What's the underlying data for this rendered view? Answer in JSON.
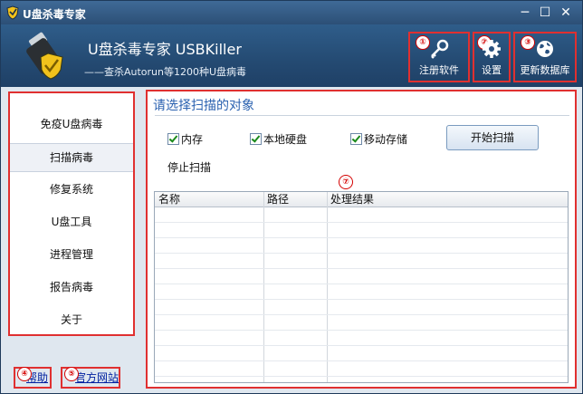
{
  "window": {
    "title": "U盘杀毒专家"
  },
  "header": {
    "app_name": "U盘杀毒专家   USBKiller",
    "tagline": "——查杀Autorun等1200种U盘病毒",
    "buttons": [
      {
        "label": "注册软件",
        "badge": "①",
        "icon": "key-icon"
      },
      {
        "label": "设置",
        "badge": "②",
        "icon": "gear-icon"
      },
      {
        "label": "更新数据库",
        "badge": "③",
        "icon": "globe-icon"
      }
    ]
  },
  "sidebar": {
    "badge": "⑥",
    "items": [
      {
        "label": "免疫U盘病毒"
      },
      {
        "label": "扫描病毒"
      },
      {
        "label": "修复系统"
      },
      {
        "label": "U盘工具"
      },
      {
        "label": "进程管理"
      },
      {
        "label": "报告病毒"
      },
      {
        "label": "关于"
      }
    ]
  },
  "footer": {
    "help": {
      "label": "帮助",
      "badge": "④"
    },
    "website": {
      "label": "官方网站",
      "badge": "⑤"
    }
  },
  "main": {
    "heading": "请选择扫描的对象",
    "badge": "⑦",
    "options": [
      {
        "label": "内存",
        "checked": true
      },
      {
        "label": "本地硬盘",
        "checked": true
      },
      {
        "label": "移动存储",
        "checked": true
      }
    ],
    "start_button": "开始扫描",
    "stop_label": "停止扫描",
    "table": {
      "columns": [
        "名称",
        "路径",
        "处理结果"
      ]
    }
  }
}
